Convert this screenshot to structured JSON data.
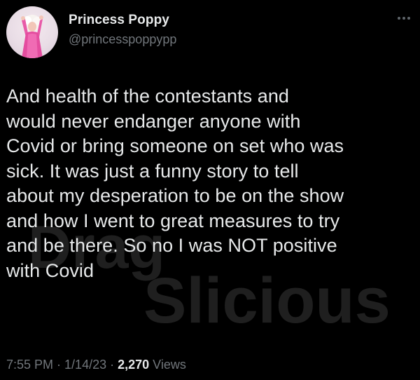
{
  "user": {
    "display_name": "Princess Poppy",
    "handle": "@princesspoppypp",
    "avatar_icon": "profile-photo"
  },
  "more_icon": "more-options-icon",
  "tweet": {
    "text": "And health of the contestants and\nwould never endanger anyone with\nCovid or bring someone on set who was\nsick. It was just a funny story to tell\nabout my desperation to be on the show\nand how I went to great measures to try\nand be there. So no I was NOT positive\nwith Covid"
  },
  "meta": {
    "time": "7:55 PM",
    "separator1": " · ",
    "date": "1/14/23",
    "separator2": " · ",
    "views_count": "2,270",
    "views_label": " Views"
  },
  "watermark": {
    "line1": "Drag",
    "line2": "Slicious"
  },
  "colors": {
    "background": "#000000",
    "primary_text": "#e7e9ea",
    "secondary_text": "#71767b",
    "avatar_pink": "#e85aa8"
  }
}
